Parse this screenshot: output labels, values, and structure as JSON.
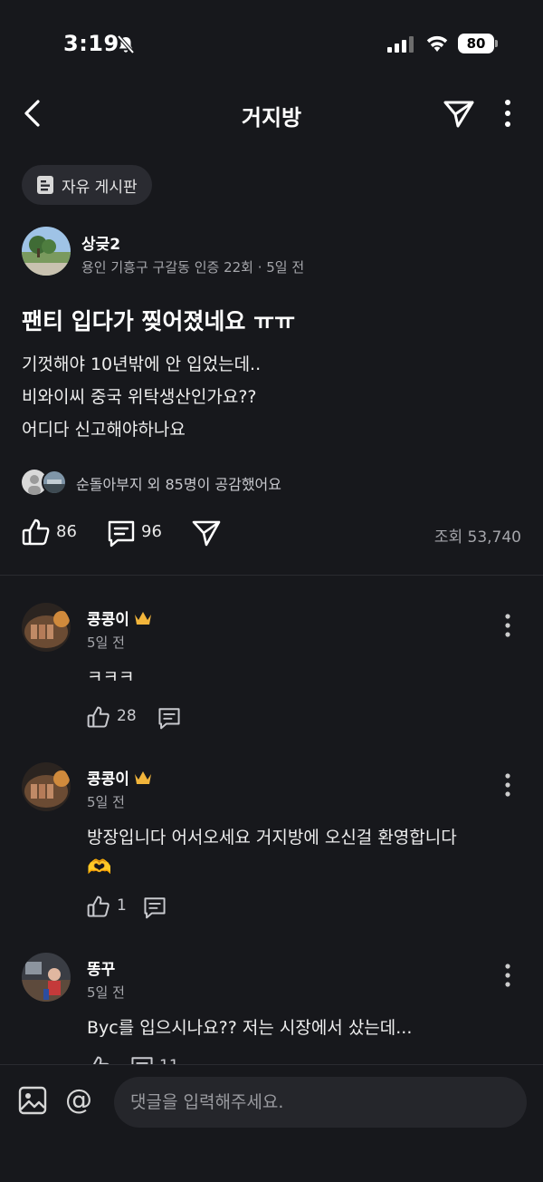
{
  "status_bar": {
    "time": "3:19",
    "battery": "80"
  },
  "header": {
    "title": "거지방"
  },
  "board": {
    "label": "자유 게시판"
  },
  "post": {
    "author": "상긎2",
    "meta": "용인 기흥구 구갈동 인증 22회 · 5일 전",
    "title": "팬티 입다가 찢어졌네요 ㅠㅠ",
    "body_lines": [
      "기껏해야 10년밖에 안 입었는데..",
      "비와이씨 중국 위탁생산인가요??",
      "어디다 신고해야하나요"
    ],
    "likers_text": "순돌아부지 외 85명이 공감했어요",
    "like_count": "86",
    "comment_count": "96",
    "views": "조회 53,740"
  },
  "comments": [
    {
      "name": "콩콩이",
      "crown": true,
      "time": "5일 전",
      "body": "ㅋㅋㅋ",
      "likes": "28",
      "replies": ""
    },
    {
      "name": "콩콩이",
      "crown": true,
      "time": "5일 전",
      "body": "방장입니다 어서오세요 거지방에 오신걸 환영합니다",
      "emoji": "🫶",
      "likes": "1",
      "replies": ""
    },
    {
      "name": "똥꾸",
      "crown": false,
      "time": "5일 전",
      "body": "Byc를 입으시나요?? 저는 시장에서 샀는데...",
      "likes": "",
      "replies": "11"
    }
  ],
  "composer": {
    "placeholder": "댓글을 입력해주세요."
  },
  "colors": {
    "background": "#17181c",
    "muted": "#a5a6ab",
    "chip": "#2a2b31",
    "crown": "#f2b53b"
  }
}
